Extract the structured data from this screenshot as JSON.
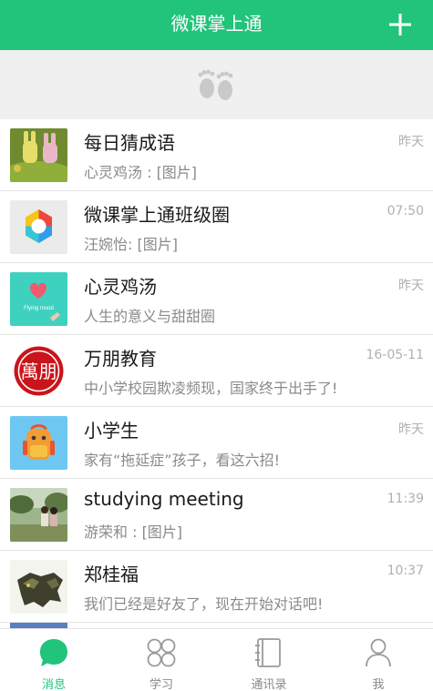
{
  "header": {
    "title": "微课掌上通"
  },
  "messages": [
    {
      "name": "每日猜成语",
      "time": "昨天",
      "preview": "心灵鸡汤 : [图片]"
    },
    {
      "name": "微课掌上通班级圈",
      "time": "07:50",
      "preview": "汪婉怡: [图片]"
    },
    {
      "name": "心灵鸡汤",
      "time": "昨天",
      "preview": "人生的意义与甜甜圈",
      "avatar_text": "Flying mood"
    },
    {
      "name": "万朋教育",
      "time": "16-05-11",
      "preview": "中小学校园欺凌频现，国家终于出手了!",
      "avatar_text": "萬朋"
    },
    {
      "name": "小学生",
      "time": "昨天",
      "preview": "家有“拖延症”孩子，看这六招!"
    },
    {
      "name": "studying meeting",
      "time": "11:39",
      "preview": "游荣和 : [图片]"
    },
    {
      "name": "郑桂福",
      "time": "10:37",
      "preview": "我们已经是好友了，现在开始对话吧!"
    }
  ],
  "tabs": [
    {
      "label": "消息",
      "icon": "chat-bubble-icon",
      "active": true
    },
    {
      "label": "学习",
      "icon": "grid-icon",
      "active": false
    },
    {
      "label": "通讯录",
      "icon": "contacts-book-icon",
      "active": false
    },
    {
      "label": "我",
      "icon": "person-icon",
      "active": false
    }
  ],
  "colors": {
    "accent": "#22c37a",
    "bar": "#22c37a"
  }
}
